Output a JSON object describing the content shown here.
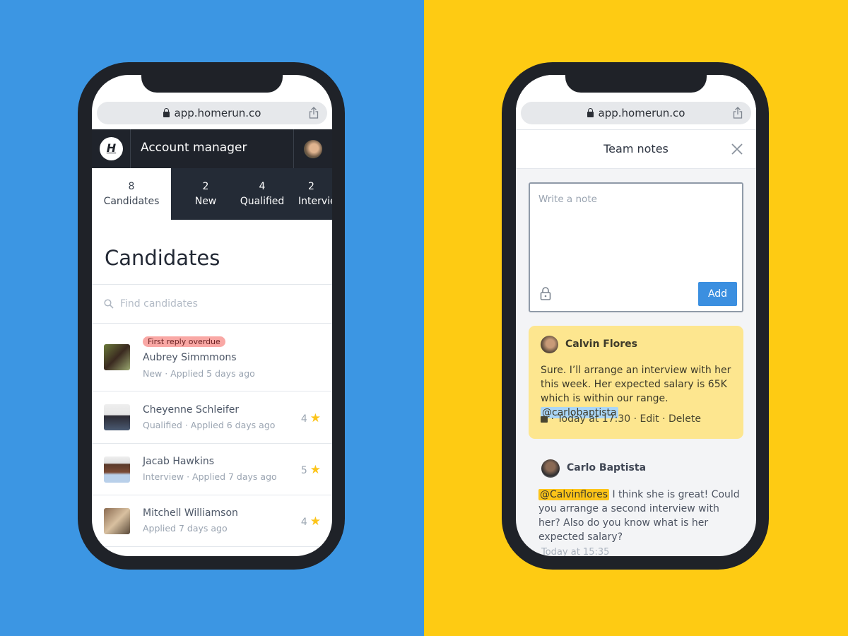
{
  "colors": {
    "left_bg": "#3c96e3",
    "right_bg": "#fecb13",
    "accent": "#3b8fe0",
    "star": "#fcc419",
    "overdue_badge": "#f9a8a5",
    "note_yellow": "#fde68f",
    "mention_blue": "#aad6f7",
    "mention_yellow": "#fcc419"
  },
  "left": {
    "url": "app.homerun.co",
    "logo": "H",
    "header_title": "Account manager",
    "tabs": [
      {
        "count": "8",
        "label": "Candidates"
      },
      {
        "count": "2",
        "label": "New"
      },
      {
        "count": "4",
        "label": "Qualified"
      },
      {
        "count": "2",
        "label": "Interview"
      }
    ],
    "page_title": "Candidates",
    "search_placeholder": "Find candidates",
    "candidates": [
      {
        "badge": "First reply overdue",
        "name": "Aubrey Simmmons",
        "meta": "New · Applied 5 days ago",
        "rating": null
      },
      {
        "name": "Cheyenne Schleifer",
        "meta": "Qualified · Applied 6 days ago",
        "rating": "4"
      },
      {
        "name": "Jacab Hawkins",
        "meta": "Interview · Applied 7 days ago",
        "rating": "5"
      },
      {
        "name": "Mitchell Williamson",
        "meta": "Applied 7 days ago",
        "rating": "4"
      }
    ]
  },
  "right": {
    "url": "app.homerun.co",
    "title": "Team notes",
    "note_placeholder": "Write a note",
    "add_label": "Add",
    "notes": [
      {
        "author": "Calvin Flores",
        "text": "Sure. I’ll arrange an interview with her this week. Her expected salary is 65K which is within our range.",
        "mention": "@carlobaptista",
        "time": " · Today at 17:30 · ",
        "edit": "Edit",
        "sep": " · ",
        "delete": "Delete"
      },
      {
        "author": "Carlo Baptista",
        "mention": "@Calvinflores",
        "text": " I think she is great! Could you arrange a second interview with her? Also do you know what is her expected salary?",
        "time": "Today at 15:35"
      }
    ]
  }
}
